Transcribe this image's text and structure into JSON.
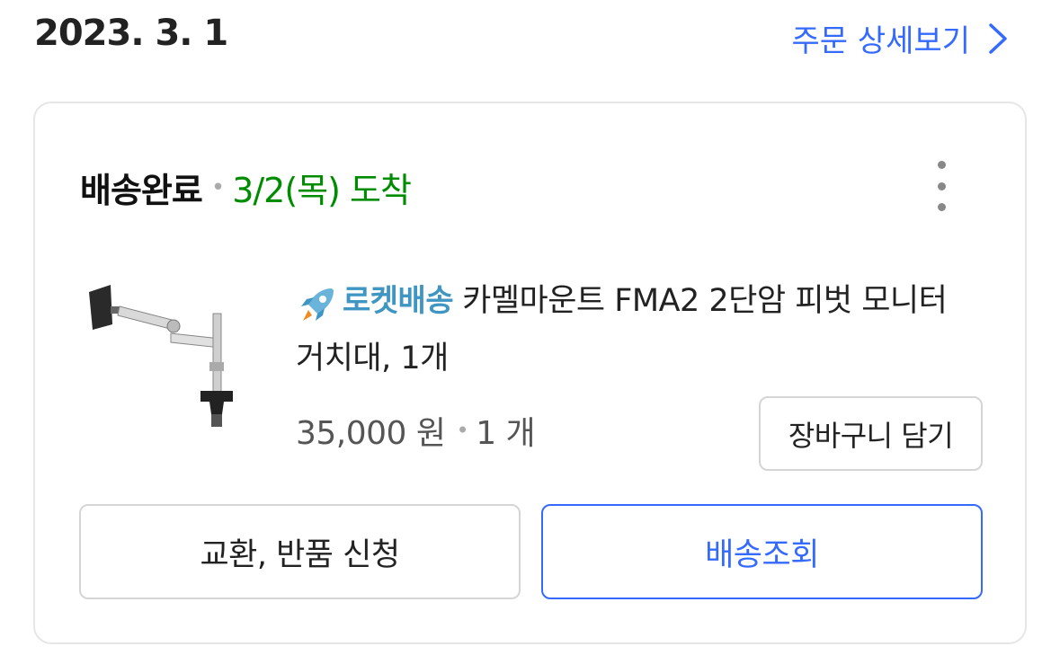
{
  "header": {
    "order_date": "2023. 3. 1",
    "detail_link_label": "주문 상세보기"
  },
  "order": {
    "status": "배송완료",
    "arrival": "3/2(목) 도착",
    "product": {
      "badge_label": "로켓배송",
      "name": "카멜마운트 FMA2 2단암 피벗 모니터 거치대, 1개",
      "price": "35,000 원",
      "quantity": "1 개"
    },
    "buttons": {
      "add_to_cart": "장바구니 담기",
      "exchange_return": "교환, 반품 신청",
      "track_delivery": "배송조회"
    }
  },
  "colors": {
    "accent": "#346aff",
    "arrival_green": "#008c00",
    "rocket_blue": "#3f96c3"
  },
  "icons": [
    "chevron-right-icon",
    "more-vertical-icon",
    "rocket-icon"
  ]
}
